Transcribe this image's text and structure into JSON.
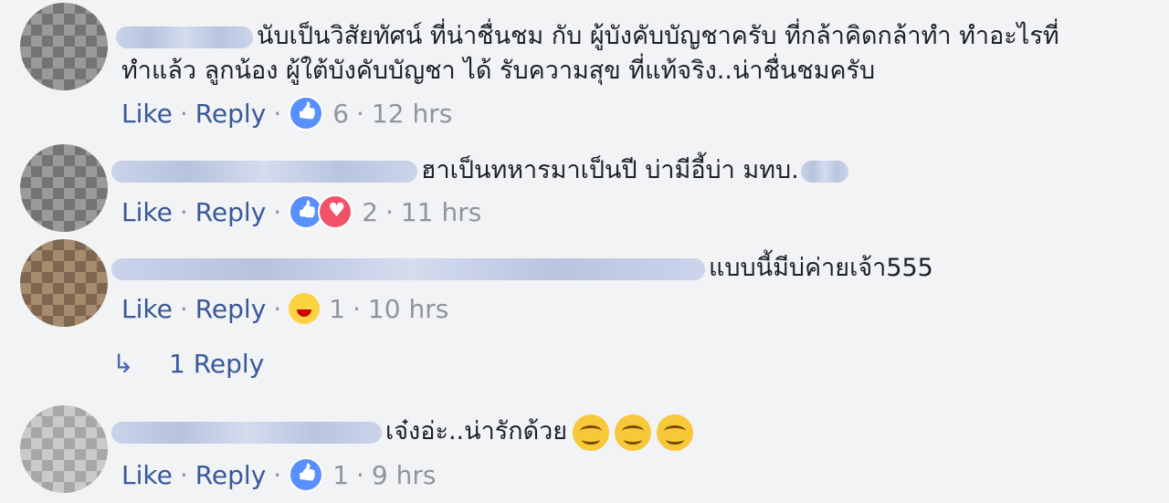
{
  "comments": [
    {
      "text_line1": "นับเป็นวิสัยทัศน์ ที่น่าชื่นชม กับ ผู้บังคับบัญชาครับ ที่กล้าคิดกล้าทำ ทำอะไรที่",
      "text_line2": "ทำแล้ว ลูกน้อง ผู้ใต้บังคับบัญชา ได้ รับความสุข ที่แท้จริง..น่าชื่นชมครับ",
      "like_label": "Like",
      "reply_label": "Reply",
      "reaction_count": "6",
      "time": "12 hrs",
      "reactions": [
        "like-icon"
      ]
    },
    {
      "text": "ฮาเป็นทหารมาเป็นปี บ่ามีอี้บ่า มทบ.",
      "like_label": "Like",
      "reply_label": "Reply",
      "reaction_count": "2",
      "time": "11 hrs",
      "reactions": [
        "like-icon",
        "love-icon"
      ]
    },
    {
      "text": "แบบนี้มีบ่ค่ายเจ้า555",
      "like_label": "Like",
      "reply_label": "Reply",
      "reaction_count": "1",
      "time": "10 hrs",
      "reactions": [
        "haha-icon"
      ],
      "replies_label": "1 Reply"
    },
    {
      "text": "เจ๋งอ่ะ..น่ารักด้วย",
      "like_label": "Like",
      "reply_label": "Reply",
      "reaction_count": "1",
      "time": "9 hrs",
      "reactions": [
        "like-icon"
      ],
      "emoji_suffix": [
        "smiling-face-icon",
        "smiling-face-icon",
        "smiling-face-icon"
      ]
    }
  ],
  "separator": "·",
  "colors": {
    "background": "#f2f3f5",
    "link": "#385898",
    "meta": "#90949c",
    "text": "#1d2129",
    "like_blue": "#5890ff",
    "love_red": "#f25268",
    "haha_yellow": "#fcd440"
  }
}
